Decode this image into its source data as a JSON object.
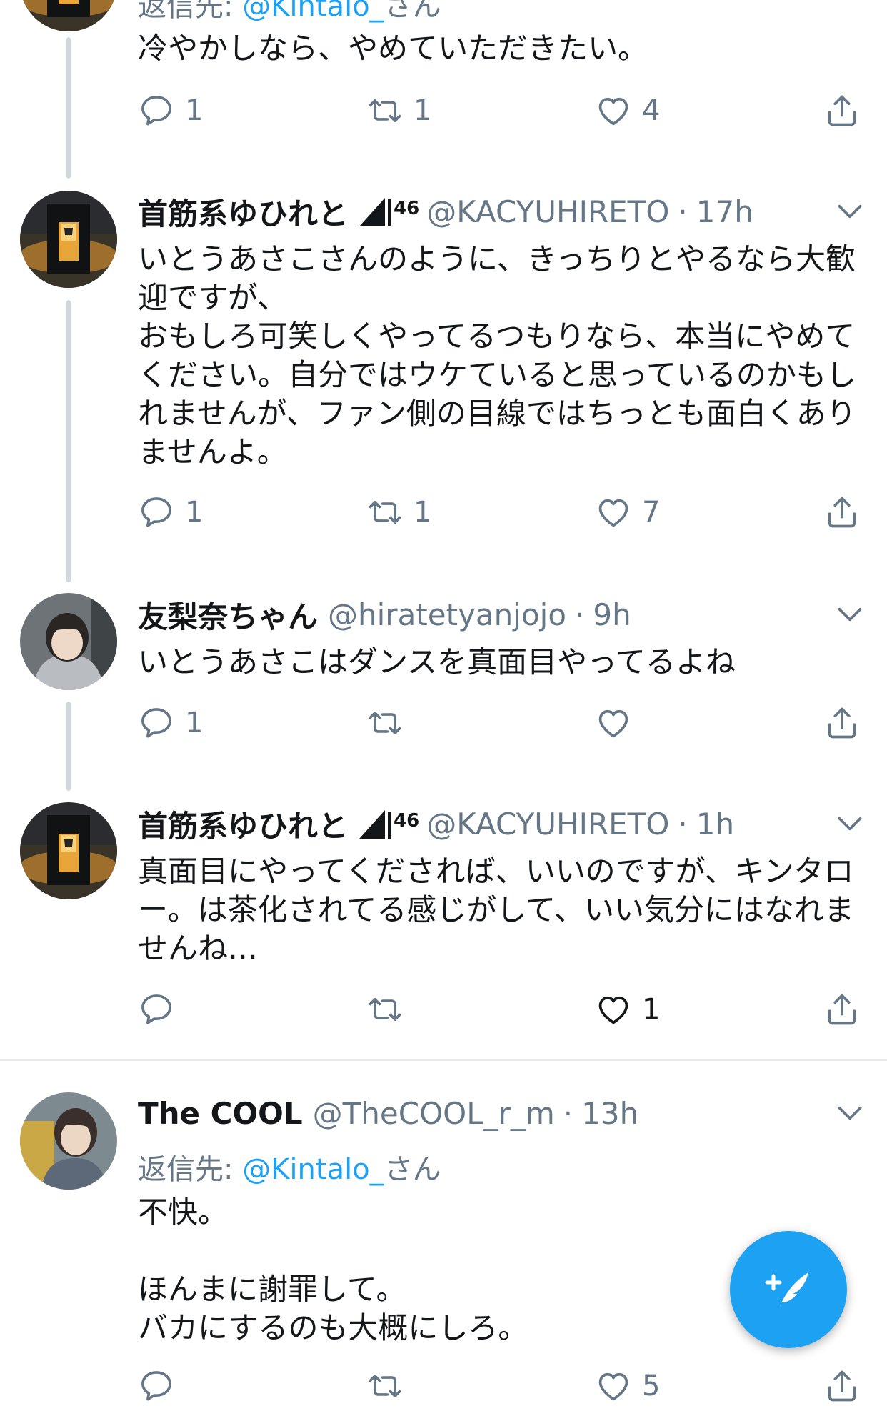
{
  "top_tweet": {
    "reply_to_prefix": "返信先:",
    "reply_to_mention": "@Kintalo_",
    "reply_to_suffix": "さん",
    "text": "冷やかしなら、やめていただきたい。",
    "counts": {
      "reply": "1",
      "retweet": "1",
      "like": "4"
    }
  },
  "tweets": [
    {
      "name": "首筋系ゆひれと",
      "badge_sup": "46",
      "handle": "@KACYUHIRETO",
      "dot": "·",
      "time": "17h",
      "text": "いとうあさこさんのように、きっちりとやるなら大歓\n迎ですが、\nおもしろ可笑しくやってるつもりなら、本当にやめて\nください。自分ではウケていると思っているのかもし\nれませんが、ファン側の目線ではちっとも面白くあり\nませんよ。",
      "counts": {
        "reply": "1",
        "retweet": "1",
        "like": "7"
      }
    },
    {
      "name": "友梨奈ちゃん",
      "handle": "@hiratetyanjojo",
      "dot": "·",
      "time": "9h",
      "text": "いとうあさこはダンスを真面目やってるよね",
      "counts": {
        "reply": "1",
        "retweet": "",
        "like": ""
      }
    },
    {
      "name": "首筋系ゆひれと",
      "badge_sup": "46",
      "handle": "@KACYUHIRETO",
      "dot": "·",
      "time": "1h",
      "text": "真面目にやってくだされば、いいのですが、キンタロ\nー。は茶化されてる感じがして、いい気分にはなれま\nせんね…",
      "counts": {
        "reply": "",
        "retweet": "",
        "like": "1"
      }
    },
    {
      "name": "The COOL",
      "handle": "@TheCOOL_r_m",
      "dot": "·",
      "time": "13h",
      "reply_to_prefix": "返信先:",
      "reply_to_mention": "@Kintalo_",
      "reply_to_suffix": "さん",
      "text": "不快。\n\nほんまに謝罪して。\nバカにするのも大概にしろ。",
      "counts": {
        "reply": "",
        "retweet": "",
        "like": "5"
      }
    }
  ],
  "icons": {
    "reply": "speech-bubble-icon",
    "retweet": "retweet-icon",
    "like": "heart-icon",
    "share": "share-icon",
    "more": "chevron-down-icon",
    "compose": "compose-tweet-icon"
  },
  "colors": {
    "accent": "#1da1f2",
    "secondary_text": "#657786",
    "thread_line": "#d0d7dd",
    "separator": "#e6ecf0"
  }
}
